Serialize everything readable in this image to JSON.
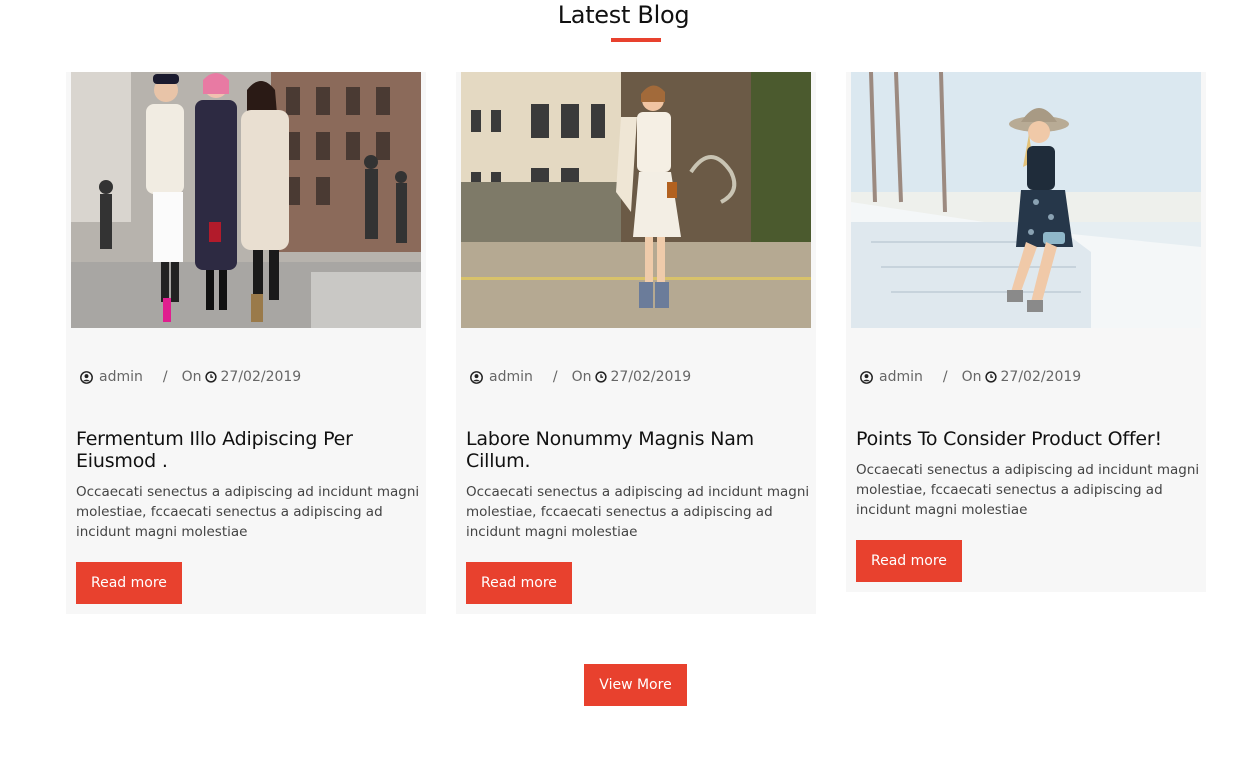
{
  "section": {
    "title": "Latest Blog"
  },
  "posts": [
    {
      "author": "admin",
      "on_label": "On",
      "date": "27/02/2019",
      "title": "Fermentum Illo Adipiscing Per Eiusmod .",
      "excerpt": "Occaecati senectus a adipiscing ad incidunt magni molestiae, fccaecati senectus a adipiscing ad incidunt magni molestiae",
      "button": "Read more"
    },
    {
      "author": "admin",
      "on_label": "On",
      "date": "27/02/2019",
      "title": "Labore Nonummy Magnis Nam Cillum.",
      "excerpt": "Occaecati senectus a adipiscing ad incidunt magni molestiae, fccaecati senectus a adipiscing ad incidunt magni molestiae",
      "button": "Read more"
    },
    {
      "author": "admin",
      "on_label": "On",
      "date": "27/02/2019",
      "title": "Points To Consider Product Offer!",
      "excerpt": "Occaecati senectus a adipiscing ad incidunt magni molestiae, fccaecati senectus a adipiscing ad incidunt magni molestiae",
      "button": "Read more"
    }
  ],
  "view_more": "View More",
  "colors": {
    "accent": "#e8412e",
    "card_bg": "#f7f7f7"
  },
  "icons": {
    "author": "user-circle-icon",
    "date": "clock-icon"
  }
}
